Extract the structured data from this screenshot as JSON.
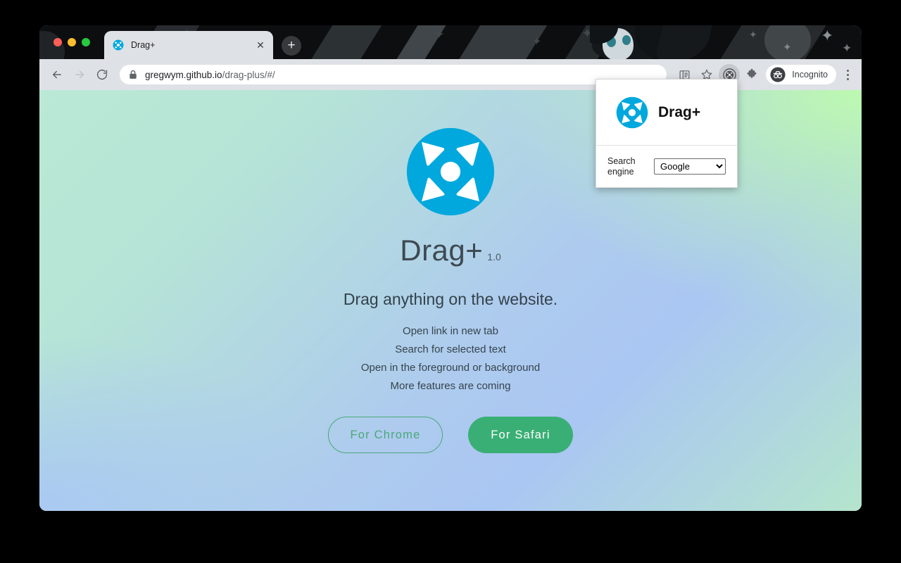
{
  "browser": {
    "tab": {
      "title": "Drag+",
      "favicon_icon": "drag-plus-favicon",
      "close_icon": "close-icon"
    },
    "new_tab_icon": "plus-icon",
    "window_controls": [
      "close",
      "minimize",
      "maximize"
    ],
    "toolbar": {
      "back_icon": "arrow-left-icon",
      "forward_icon": "arrow-right-icon",
      "reload_icon": "reload-icon",
      "lock_icon": "lock-icon",
      "url_host": "gregwym.github.io",
      "url_path": "/drag-plus/#/",
      "reading_list_icon": "reading-list-icon",
      "bookmark_icon": "star-icon",
      "extension_icon": "drag-plus-extension-icon",
      "extensions_puzzle_icon": "puzzle-icon",
      "incognito_icon": "incognito-icon",
      "incognito_label": "Incognito",
      "menu_icon": "three-dots-icon"
    }
  },
  "popup": {
    "logo_icon": "drag-plus-logo",
    "title": "Drag+",
    "search_engine_label": "Search engine",
    "search_engine_value": "Google",
    "search_engine_options": [
      "Google"
    ]
  },
  "page": {
    "logo_icon": "drag-plus-logo",
    "title": "Drag+",
    "version": "1.0",
    "tagline": "Drag anything on the website.",
    "features": [
      "Open link in new tab",
      "Search for selected text",
      "Open in the foreground or background",
      "More features are coming"
    ],
    "cta": {
      "chrome_label": "For Chrome",
      "safari_label": "For Safari"
    }
  },
  "colors": {
    "brand_cyan": "#00a8dd",
    "safari_green": "#3aaf75",
    "chrome_green": "#49a87a",
    "gradient_top_left": "#b8e8d4",
    "gradient_top_right": "#bdfaac",
    "gradient_bottom_left": "#aac8f5",
    "gradient_bottom_right": "#b4e8ce"
  }
}
